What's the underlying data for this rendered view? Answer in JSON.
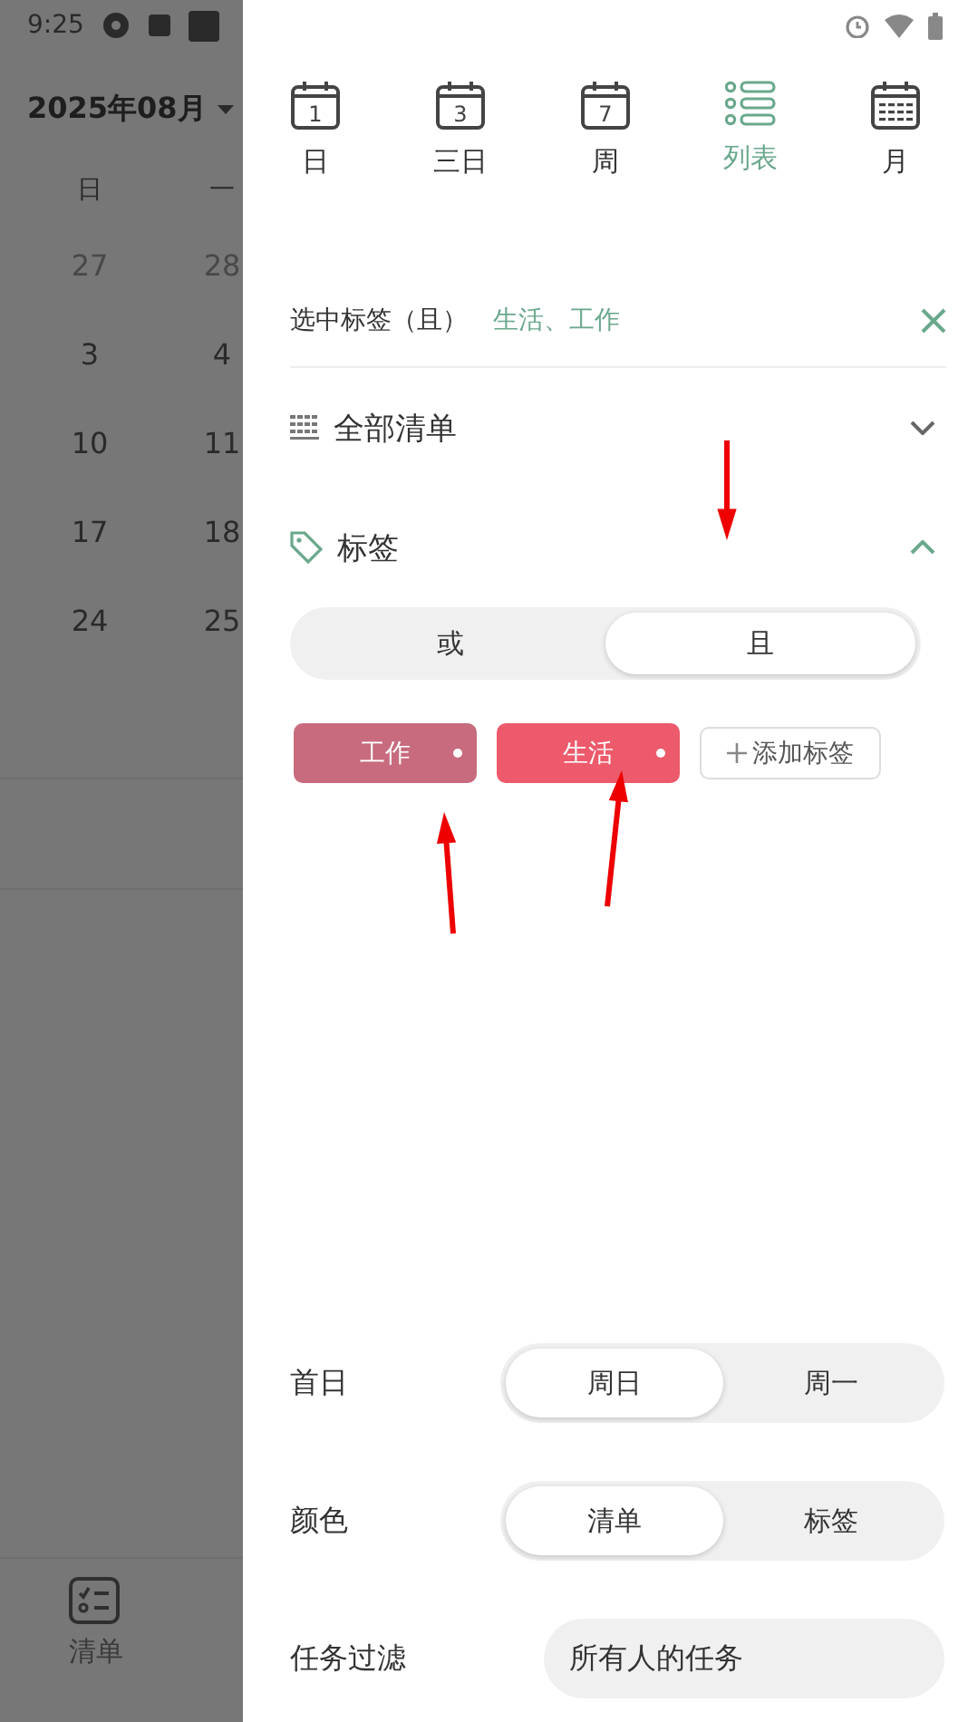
{
  "background": {
    "status_bar": {
      "time": "9:25"
    },
    "month_title": "2025年08月",
    "weekdays": [
      "日",
      "一"
    ],
    "weeks": [
      {
        "days": [
          "27",
          "28"
        ],
        "faded": true
      },
      {
        "days": [
          "3",
          "4"
        ],
        "faded": false
      },
      {
        "days": [
          "10",
          "11"
        ],
        "faded": false
      },
      {
        "days": [
          "17",
          "18"
        ],
        "faded": false
      },
      {
        "days": [
          "24",
          "25"
        ],
        "faded": false
      }
    ],
    "bottom_nav": {
      "label": "清单"
    }
  },
  "drawer": {
    "view_tabs": [
      {
        "label": "日",
        "kind": "day",
        "icon_text": "1",
        "selected": false
      },
      {
        "label": "三日",
        "kind": "day",
        "icon_text": "3",
        "selected": false
      },
      {
        "label": "周",
        "kind": "day",
        "icon_text": "7",
        "selected": false
      },
      {
        "label": "列表",
        "kind": "list",
        "selected": true
      },
      {
        "label": "月",
        "kind": "month",
        "selected": false
      }
    ],
    "selected_filter": {
      "label": "选中标签（且）",
      "value": "生活、工作"
    },
    "sections": [
      {
        "title": "全部清单",
        "kind": "lists",
        "expanded": false
      },
      {
        "title": "标签",
        "kind": "tags",
        "expanded": true
      }
    ],
    "tag_mode": [
      {
        "label": "或",
        "selected": false
      },
      {
        "label": "且",
        "selected": true
      }
    ],
    "tags": [
      {
        "label": "工作",
        "color": "#c86b7e"
      },
      {
        "label": "生活",
        "color": "#ec5a6b"
      }
    ],
    "add_tag": "添加标签",
    "settings": [
      {
        "label": "首日",
        "options": [
          {
            "label": "周日",
            "selected": true
          },
          {
            "label": "周一",
            "selected": false
          }
        ]
      },
      {
        "label": "颜色",
        "options": [
          {
            "label": "清单",
            "selected": true
          },
          {
            "label": "标签",
            "selected": false
          }
        ]
      }
    ],
    "task_filter": {
      "label": "任务过滤",
      "value": "所有人的任务"
    }
  }
}
